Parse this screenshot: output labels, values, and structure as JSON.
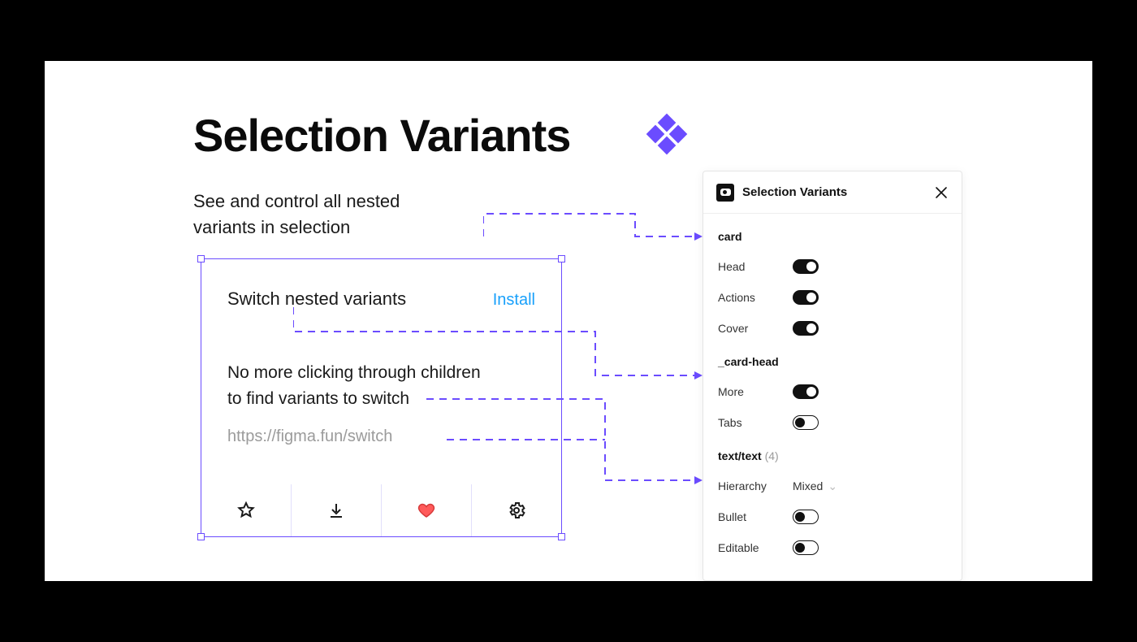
{
  "title": "Selection Variants",
  "subtitle": "See and control all nested variants in selection",
  "card": {
    "title": "Switch nested variants",
    "install_label": "Install",
    "body_line1": "No more clicking through children",
    "body_line2": "to find variants to switch",
    "url": "https://figma.fun/switch"
  },
  "panel": {
    "title": "Selection Variants",
    "groups": [
      {
        "name": "card",
        "props": [
          {
            "label": "Head",
            "type": "toggle",
            "on": true
          },
          {
            "label": "Actions",
            "type": "toggle",
            "on": true
          },
          {
            "label": "Cover",
            "type": "toggle",
            "on": true
          }
        ]
      },
      {
        "name": "_card-head",
        "props": [
          {
            "label": "More",
            "type": "toggle",
            "on": true
          },
          {
            "label": "Tabs",
            "type": "toggle",
            "on": false
          }
        ]
      },
      {
        "name": "text/text",
        "count": "(4)",
        "props": [
          {
            "label": "Hierarchy",
            "type": "dropdown",
            "value": "Mixed"
          },
          {
            "label": "Bullet",
            "type": "toggle",
            "on": false
          },
          {
            "label": "Editable",
            "type": "toggle",
            "on": false
          }
        ]
      }
    ]
  },
  "icons": {
    "star": "star-icon",
    "download": "download-icon",
    "heart": "heart-icon",
    "gear": "gear-icon"
  }
}
